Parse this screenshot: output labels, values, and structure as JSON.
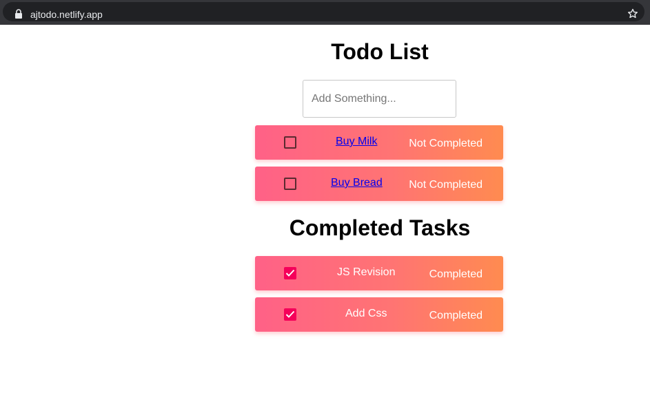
{
  "browser": {
    "url": "ajtodo.netlify.app",
    "icons": [
      "lock-icon",
      "star-icon"
    ]
  },
  "todo": {
    "title": "Todo List",
    "input_placeholder": "Add Something...",
    "items": [
      {
        "label": "Buy Milk",
        "status": "Not Completed",
        "checked": false
      },
      {
        "label": "Buy Bread",
        "status": "Not Completed",
        "checked": false
      }
    ]
  },
  "completed": {
    "title": "Completed Tasks",
    "items": [
      {
        "label": "JS Revision",
        "status": "Completed",
        "checked": true
      },
      {
        "label": "Add Css",
        "status": "Completed",
        "checked": true
      }
    ]
  },
  "colors": {
    "item_gradient_start": "#ff6187",
    "item_gradient_end": "#ff8b50",
    "checked_box": "#f5005a",
    "link": "#0000ee"
  }
}
